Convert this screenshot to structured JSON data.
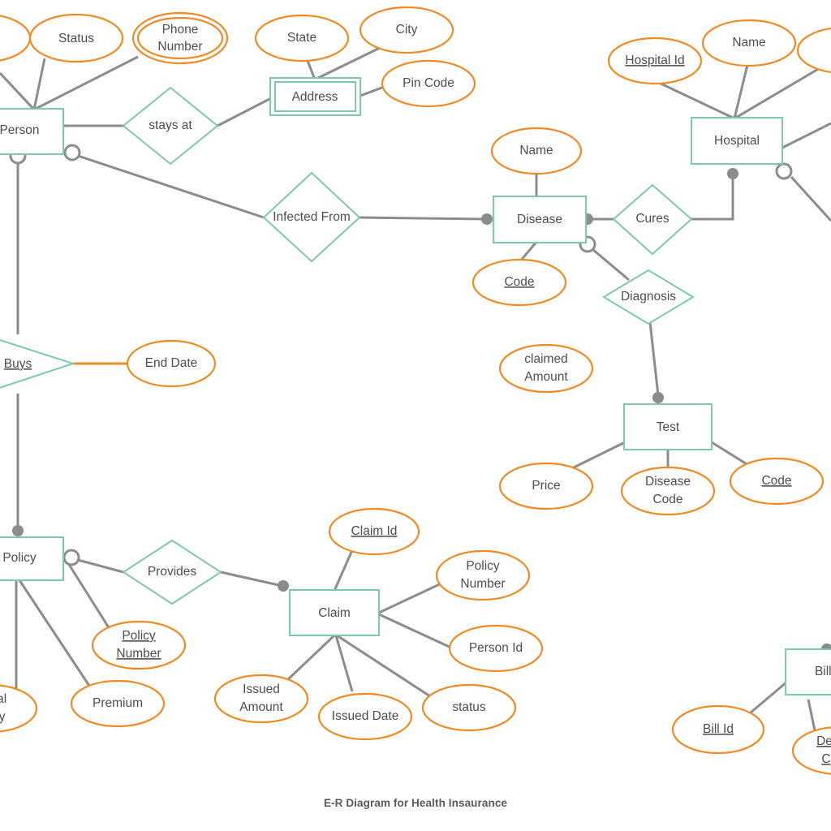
{
  "diagram": {
    "caption": "E-R Diagram for Health Insaurance",
    "colors": {
      "entity_stroke": "#7fc8a9",
      "attribute_stroke": "#f08a24",
      "edge": "#8c8c8c",
      "text": "#4d4d4d",
      "background": "#ffffff"
    },
    "entities": [
      {
        "id": "person",
        "label": "Person",
        "weak": false,
        "clipped": "left"
      },
      {
        "id": "address",
        "label": "Address",
        "weak": true,
        "clipped": "none"
      },
      {
        "id": "disease",
        "label": "Disease",
        "weak": false,
        "clipped": "none"
      },
      {
        "id": "hospital",
        "label": "Hospital",
        "weak": false,
        "clipped": "none"
      },
      {
        "id": "test",
        "label": "Test",
        "weak": false,
        "clipped": "none"
      },
      {
        "id": "policy",
        "label": "Policy",
        "weak": false,
        "clipped": "left"
      },
      {
        "id": "claim",
        "label": "Claim",
        "weak": false,
        "clipped": "none"
      },
      {
        "id": "billing",
        "label": "Billing",
        "weak": false,
        "clipped": "right"
      }
    ],
    "relationships": [
      {
        "id": "stays-at",
        "label": "stays at",
        "identifying": false
      },
      {
        "id": "infected-from",
        "label": "Infected From",
        "identifying": false
      },
      {
        "id": "cures",
        "label": "Cures",
        "identifying": false
      },
      {
        "id": "diagnosis",
        "label": "Diagnosis",
        "identifying": false
      },
      {
        "id": "buys",
        "label": "Buys",
        "identifying": false,
        "key": true,
        "clipped": "left"
      },
      {
        "id": "provides",
        "label": "Provides",
        "identifying": false
      }
    ],
    "attributes": [
      {
        "id": "person-partial-left",
        "label": "",
        "owner": "person",
        "key": false,
        "multivalued": false,
        "clipped": "left"
      },
      {
        "id": "status",
        "label": "Status",
        "owner": "person",
        "key": false,
        "multivalued": false
      },
      {
        "id": "phone-number",
        "label": "Phone\nNumber",
        "owner": "person",
        "key": false,
        "multivalued": true
      },
      {
        "id": "state",
        "label": "State",
        "owner": "address",
        "key": false,
        "multivalued": false
      },
      {
        "id": "city",
        "label": "City",
        "owner": "address",
        "key": false,
        "multivalued": false
      },
      {
        "id": "pin-code",
        "label": "Pin Code",
        "owner": "address",
        "key": false,
        "multivalued": false
      },
      {
        "id": "hospital-id",
        "label": "Hospital Id",
        "owner": "hospital",
        "key": true,
        "multivalued": false
      },
      {
        "id": "hospital-name",
        "label": "Name",
        "owner": "hospital",
        "key": false,
        "multivalued": false
      },
      {
        "id": "hospital-partial-right",
        "label": "",
        "owner": "hospital",
        "key": false,
        "multivalued": false,
        "clipped": "right"
      },
      {
        "id": "disease-name",
        "label": "Name",
        "owner": "disease",
        "key": false,
        "multivalued": false
      },
      {
        "id": "disease-code",
        "label": "Code",
        "owner": "disease",
        "key": true,
        "multivalued": false
      },
      {
        "id": "claimed-amount",
        "label": "claimed\nAmount",
        "owner": "none",
        "key": false,
        "multivalued": false
      },
      {
        "id": "test-price",
        "label": "Price",
        "owner": "test",
        "key": false,
        "multivalued": false
      },
      {
        "id": "test-disease-code",
        "label": "Disease\nCode",
        "owner": "test",
        "key": false,
        "multivalued": false
      },
      {
        "id": "test-code",
        "label": "Code",
        "owner": "test",
        "key": true,
        "multivalued": false
      },
      {
        "id": "end-date",
        "label": "End Date",
        "owner": "buys",
        "key": false,
        "multivalued": false
      },
      {
        "id": "medical-history",
        "label": "Medical\nHistory",
        "owner": "policy",
        "key": false,
        "multivalued": false,
        "clipped": "left"
      },
      {
        "id": "premium",
        "label": "Premium",
        "owner": "policy",
        "key": false,
        "multivalued": false
      },
      {
        "id": "policy-number",
        "label": "Policy\nNumber",
        "owner": "policy",
        "key": true,
        "multivalued": false
      },
      {
        "id": "claim-id",
        "label": "Claim Id",
        "owner": "claim",
        "key": true,
        "multivalued": false
      },
      {
        "id": "claim-policy-number",
        "label": "Policy\nNumber",
        "owner": "claim",
        "key": false,
        "multivalued": false
      },
      {
        "id": "claim-person-id",
        "label": "Person Id",
        "owner": "claim",
        "key": false,
        "multivalued": false
      },
      {
        "id": "issued-amount",
        "label": "Issued\nAmount",
        "owner": "claim",
        "key": false,
        "multivalued": false
      },
      {
        "id": "issued-date",
        "label": "Issued Date",
        "owner": "claim",
        "key": false,
        "multivalued": false
      },
      {
        "id": "claim-status",
        "label": "status",
        "owner": "claim",
        "key": false,
        "multivalued": false
      },
      {
        "id": "bill-id",
        "label": "Bill Id",
        "owner": "billing",
        "key": true,
        "multivalued": false
      },
      {
        "id": "bill-detail-code",
        "label": "Detail\nCode",
        "owner": "billing",
        "key": true,
        "multivalued": false,
        "clipped": "right"
      }
    ],
    "labels": {
      "person": "Person",
      "address": "Address",
      "disease": "Disease",
      "hospital": "Hospital",
      "test": "Test",
      "policy": "Policy",
      "claim": "Claim",
      "billing": "Billi",
      "stays_at": "stays at",
      "infected_from": "Infected From",
      "cures": "Cures",
      "diagnosis": "Diagnosis",
      "buys": "Buys",
      "provides": "Provides",
      "status": "Status",
      "phone_number_l1": "Phone",
      "phone_number_l2": "Number",
      "state": "State",
      "city": "City",
      "pin_code": "Pin Code",
      "hospital_id": "Hospital Id",
      "hospital_name": "Name",
      "disease_name": "Name",
      "disease_code": "Code",
      "claimed_amount_l1": "claimed",
      "claimed_amount_l2": "Amount",
      "test_price": "Price",
      "test_disease_code_l1": "Disease",
      "test_disease_code_l2": "Code",
      "test_code": "Code",
      "end_date": "End Date",
      "medical_history_l1": "edical",
      "medical_history_l2": "istory",
      "premium": "Premium",
      "policy_number_l1": "Policy",
      "policy_number_l2": "Number",
      "claim_id": "Claim Id",
      "claim_policy_number_l1": "Policy",
      "claim_policy_number_l2": "Number",
      "claim_person_id": "Person Id",
      "issued_amount_l1": "Issued",
      "issued_amount_l2": "Amount",
      "issued_date": "Issued Date",
      "claim_status": "status",
      "bill_id": "Bill Id",
      "bill_detail_code_l1": "De",
      "bill_detail_code_l2": "C"
    }
  }
}
